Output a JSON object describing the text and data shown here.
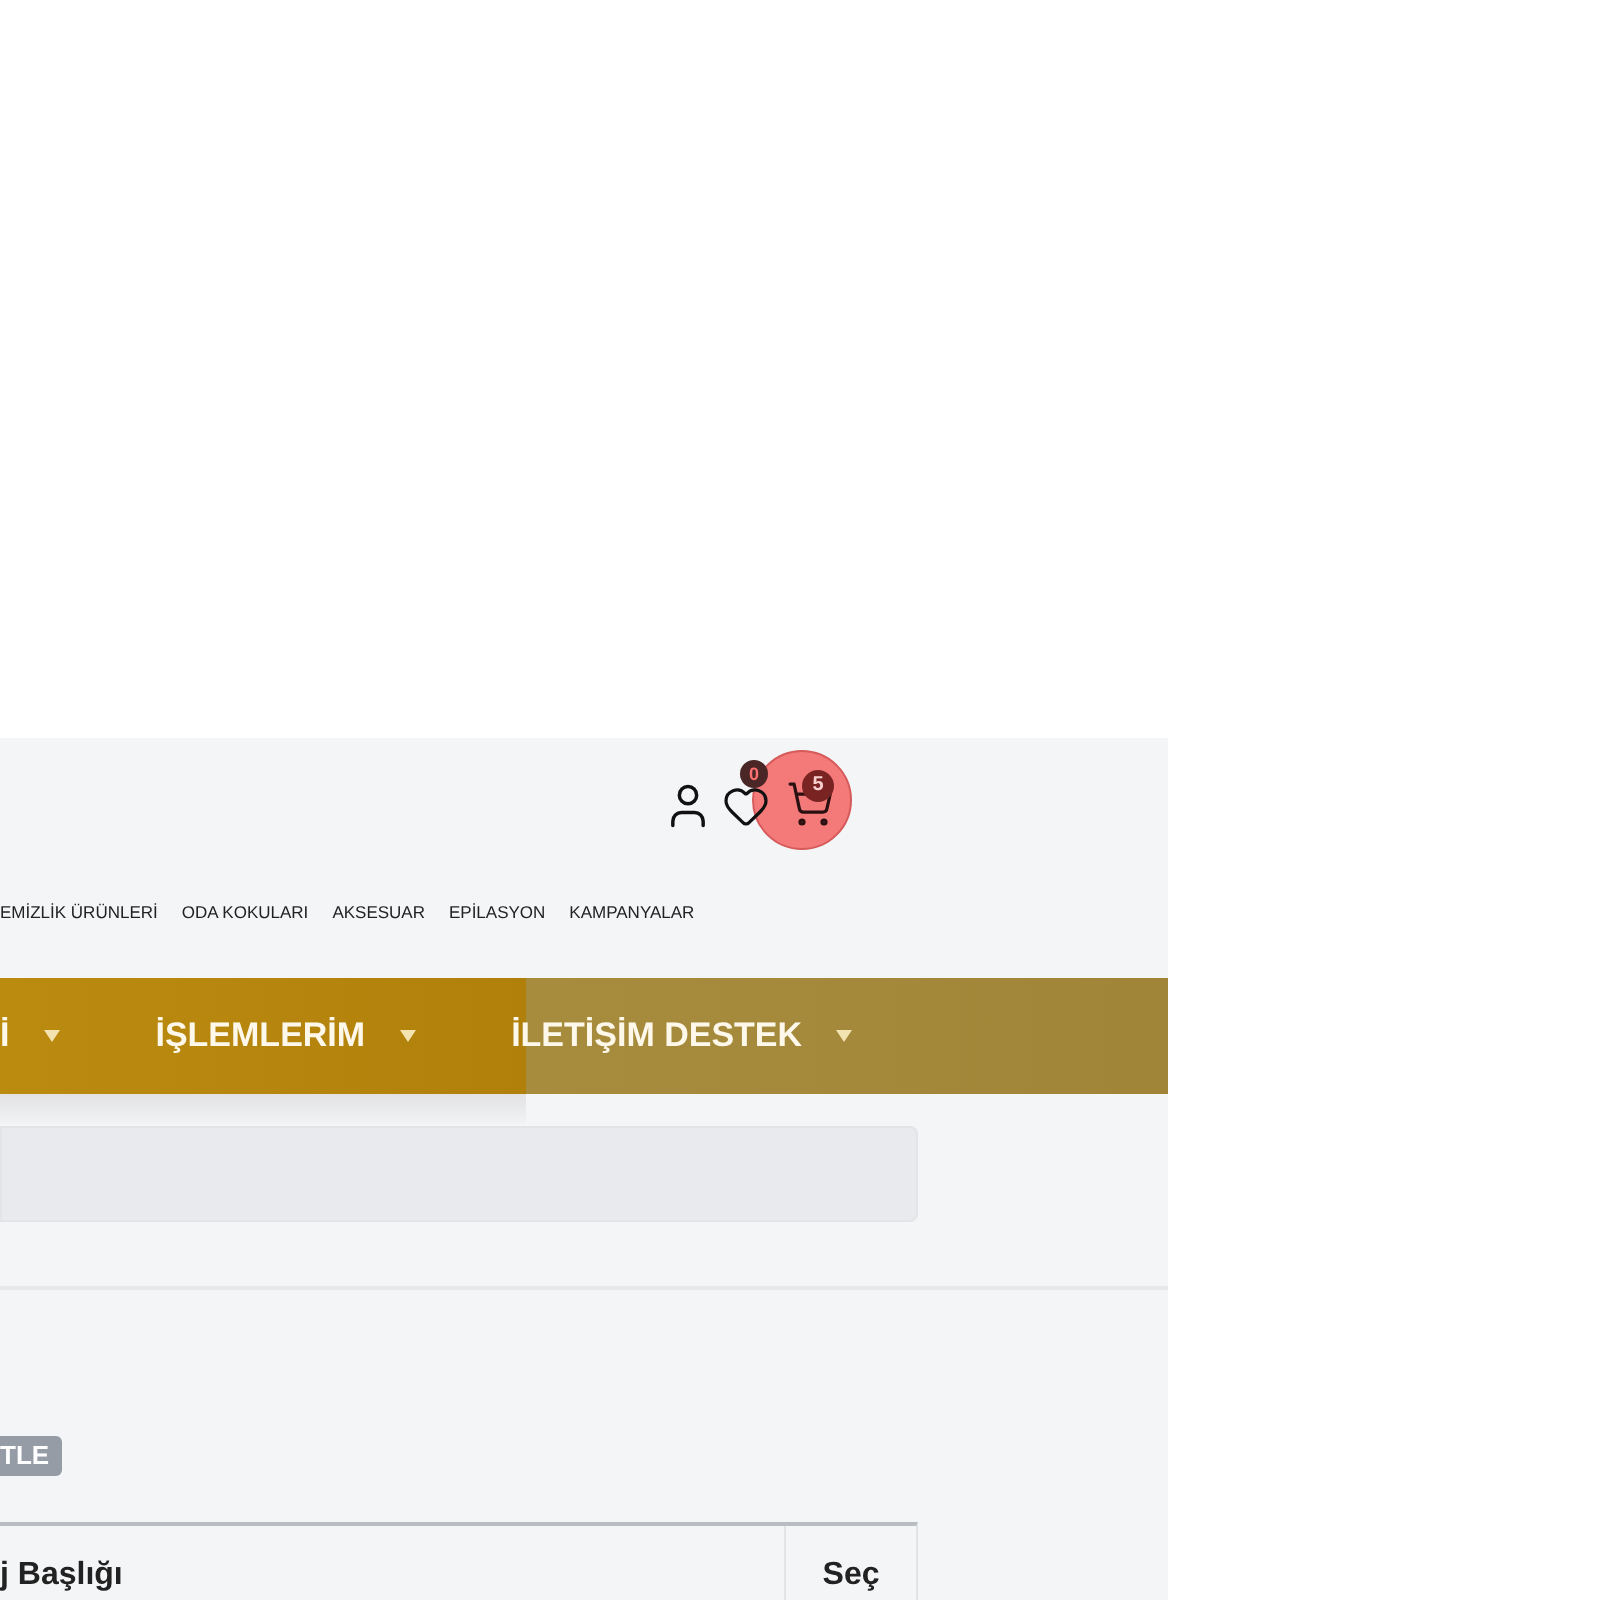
{
  "header": {
    "wishlist_count": "0",
    "cart_count": "5"
  },
  "category_links": [
    {
      "label": "EMİZLİK ÜRÜNLERİ"
    },
    {
      "label": "ODA KOKULARI"
    },
    {
      "label": "AKSESUAR"
    },
    {
      "label": "EPİLASYON"
    },
    {
      "label": "KAMPANYALAR"
    }
  ],
  "main_menu": [
    {
      "label": "İ"
    },
    {
      "label": "İŞLEMLERİM"
    },
    {
      "label": "İLETİŞİM DESTEK"
    }
  ],
  "action_button": {
    "label": "TLE"
  },
  "table": {
    "columns": [
      {
        "label": "j Başlığı"
      },
      {
        "label": "Seç"
      }
    ]
  }
}
